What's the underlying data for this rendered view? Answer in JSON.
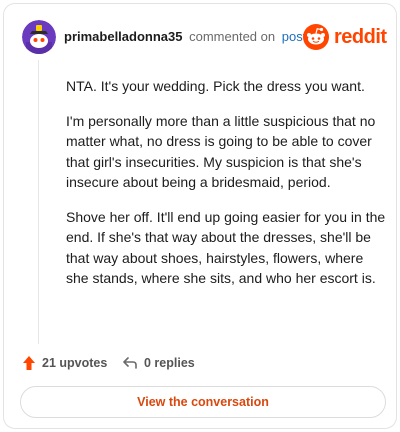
{
  "comment": {
    "author": "primabelladonna35",
    "meta_text": "commented on",
    "post_link": "post",
    "brand": "reddit",
    "paragraphs": [
      "NTA. It's your wedding. Pick the dress you want.",
      "I'm personally more than a little suspicious that no matter what, no dress is going to be able to cover that girl's insecurities. My suspicion is that she's insecure about being a bridesmaid, period.",
      "Shove her off. It'll end up going easier for you in the end. If she's that way about the dresses, she'll be that way about shoes, hairstyles, flowers, where she stands, where she sits, and who her escort is."
    ]
  },
  "actions": {
    "upvotes": "21 upvotes",
    "replies": "0 replies"
  },
  "cta": {
    "label": "View the conversation"
  },
  "colors": {
    "brand": "#ff4500",
    "link": "#1d6fbf",
    "avatar_bg": "#6a3bbf",
    "cta_text": "#d9480f"
  },
  "icons": [
    "avatar",
    "reddit-logo-icon",
    "upvote-icon",
    "reply-icon"
  ]
}
